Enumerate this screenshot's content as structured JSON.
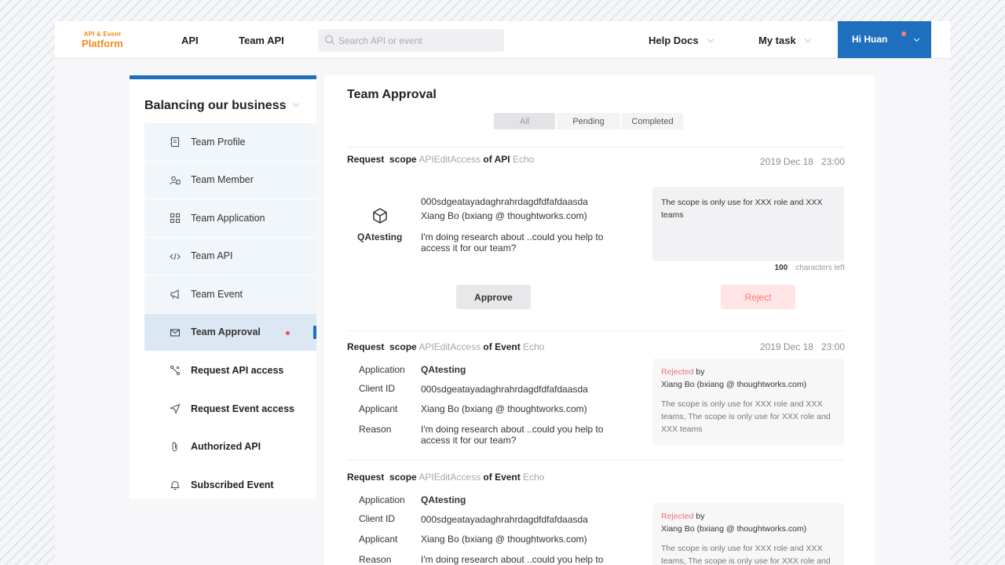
{
  "header": {
    "logo_line1": "API & Event",
    "logo_line2": "Platform",
    "nav": [
      "API",
      "Team API"
    ],
    "search_placeholder": "Search API or event",
    "help_docs": "Help Docs",
    "my_task": "My task",
    "user_name": "Hi Huan"
  },
  "sidebar": {
    "title": "Balancing our business",
    "items": [
      {
        "label": "Team Profile",
        "icon": "profile-icon"
      },
      {
        "label": "Team Member",
        "icon": "members-icon"
      },
      {
        "label": "Team Application",
        "icon": "grid-icon"
      },
      {
        "label": "Team API",
        "icon": "code-icon"
      },
      {
        "label": "Team Event",
        "icon": "megaphone-icon"
      },
      {
        "label": "Team Approval",
        "icon": "mail-icon",
        "active": true
      },
      {
        "label": "Request API access",
        "icon": "route-icon"
      },
      {
        "label": "Request Event access",
        "icon": "send-icon"
      },
      {
        "label": "Authorized API",
        "icon": "clip-icon"
      },
      {
        "label": "Subscribed Event",
        "icon": "bell-icon"
      }
    ]
  },
  "main": {
    "title": "Team Approval",
    "filters": [
      "All",
      "Pending",
      "Completed"
    ],
    "selected_filter": "All",
    "requests": [
      {
        "prefix": "Request",
        "scope_label": "scope",
        "scope": "APIEditAccess",
        "of_label": "of API",
        "target": "Echo",
        "date": "2019 Dec 18",
        "time": "23:00",
        "app": "QAtesting",
        "client_id": "000sdgeatayadaghrahrdagdfdfafdaasda",
        "applicant": "Xiang Bo (bxiang @ thoughtworks.com)",
        "reason": "I'm doing research about ..could you help to access it for our team?",
        "note": "The scope is only use for XXX role and XXX teams",
        "chars_left": "100",
        "chars_left_label": "characters left",
        "approve_label": "Approve",
        "reject_label": "Reject"
      },
      {
        "prefix": "Request",
        "scope_label": "scope",
        "scope": "APIEditAccess",
        "of_label": "of Event",
        "target": "Echo",
        "date": "2019 Dec 18",
        "time": "23:00",
        "labels": {
          "application": "Application",
          "client_id": "Client ID",
          "applicant": "Applicant",
          "reason": "Reason"
        },
        "app": "QAtesting",
        "client_id": "000sdgeatayadaghrahrdagdfdfafdaasda",
        "applicant": "Xiang Bo (bxiang @ thoughtworks.com)",
        "reason": "I'm doing research about ..could you help to access it for our team?",
        "status": "Rejected",
        "by_label": "by",
        "by": "Xiang Bo (bxiang @ thoughtworks.com)",
        "message": "The scope is only use for XXX role and XXX teams, The scope is only use for XXX role and XXX teams"
      },
      {
        "prefix": "Request",
        "scope_label": "scope",
        "scope": "APIEditAccess",
        "of_label": "of Event",
        "target": "Echo",
        "labels": {
          "application": "Application",
          "client_id": "Client ID",
          "applicant": "Applicant",
          "reason": "Reason"
        },
        "app": "QAtesting",
        "client_id": "000sdgeatayadaghrahrdagdfdfafdaasda",
        "applicant": "Xiang Bo (bxiang @ thoughtworks.com)",
        "reason": "I'm doing research about ..could you help to access it for our team?",
        "status": "Rejected",
        "by_label": "by",
        "by": "Xiang Bo (bxiang @ thoughtworks.com)",
        "message": "The scope is only use for XXX role and XXX teams, The scope is only use for XXX role and XXX teams"
      }
    ]
  },
  "colors": {
    "accent": "#1f6fbf",
    "logo": "#f28c1b",
    "reject": "#ff7b7b",
    "notification": "#f05050"
  }
}
